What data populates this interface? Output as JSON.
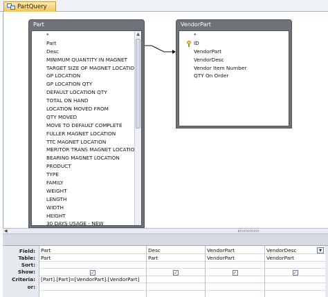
{
  "tab": {
    "label": "PartQuery"
  },
  "tables": {
    "part": {
      "title": "Part",
      "fields": [
        "*",
        "Part",
        "Desc",
        "MINIMUM QUANTITY IN MAGNET",
        "TARGET SIZE OF MAGNET LOCATION",
        "GP LOCATION",
        "GP LOCATION QTY",
        "DEFAULT LOCATION QTY",
        "TOTAL ON HAND",
        "LOCATION MOVED FROM",
        "QTY MOVED",
        "MOVE TO DEFAULT COMPLETE",
        "FULLER MAGNET LOCATION",
        "TTC MAGNET LOCATION",
        "MERITOR TRANS MAGNET LOCATION",
        "BEARING MAGNET LOCATION",
        "PRODUCT",
        "TYPE",
        "FAMILY",
        "WEIGHT",
        "LENGTH",
        "WIDTH",
        "HEIGHT",
        "30 DAYS USAGE - NEW"
      ]
    },
    "vendorpart": {
      "title": "VendorPart",
      "fields": [
        "*",
        "ID",
        "VendorPart",
        "VendorDesc",
        "Vendor Item Number",
        "QTY On Order"
      ]
    }
  },
  "grid": {
    "row_labels": [
      "Field:",
      "Table:",
      "Sort:",
      "Show:",
      "Criteria:",
      "or:"
    ],
    "columns": [
      {
        "field": "Part",
        "table": "Part",
        "show": true,
        "criteria": "[Part].[Part]=[VendorPart].[VendorPart]"
      },
      {
        "field": "Desc",
        "table": "Part",
        "show": true,
        "criteria": ""
      },
      {
        "field": "VendorPart",
        "table": "VendorPart",
        "show": true,
        "criteria": ""
      },
      {
        "field": "VendorDesc",
        "table": "VendorPart",
        "show": true,
        "criteria": ""
      }
    ],
    "checkmark": "✓",
    "dropdown_glyph": "▼"
  }
}
